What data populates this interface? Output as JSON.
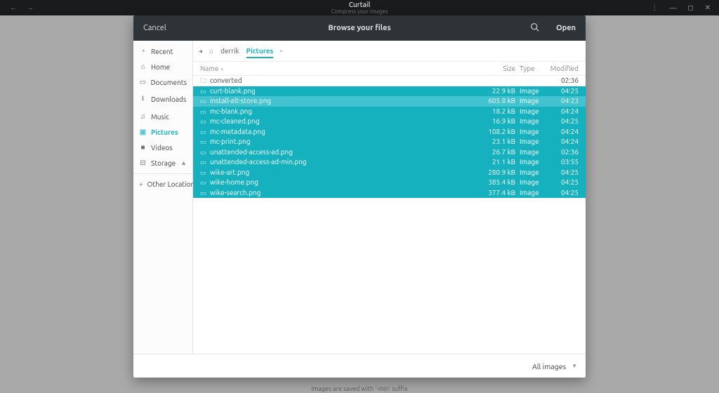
{
  "shell": {
    "app_title": "Curtail",
    "subtitle": "Compress your images"
  },
  "dialog": {
    "cancel": "Cancel",
    "title": "Browse your files",
    "open": "Open",
    "filter_label": "All images"
  },
  "sidebar": {
    "items": [
      {
        "icon": "◔",
        "label": "Recent"
      },
      {
        "icon": "⌂",
        "label": "Home"
      },
      {
        "icon": "▭",
        "label": "Documents"
      },
      {
        "icon": "⭳",
        "label": "Downloads"
      },
      {
        "icon": "♫",
        "label": "Music"
      },
      {
        "icon": "▣",
        "label": "Pictures"
      },
      {
        "icon": "■",
        "label": "Videos"
      },
      {
        "icon": "⊟",
        "label": "Storage"
      }
    ],
    "other_loc": "Other Locations"
  },
  "crumbs": {
    "seg1": "derrik",
    "seg2": "Pictures"
  },
  "columns": {
    "name": "Name",
    "size": "Size",
    "type": "Type",
    "modified": "Modified"
  },
  "files": [
    {
      "kind": "folder",
      "name": "converted",
      "size": "",
      "type": "",
      "mod": "02:36",
      "sel": false
    },
    {
      "kind": "image",
      "name": "curt-blank.png",
      "size": "22.9 kB",
      "type": "Image",
      "mod": "04:25",
      "sel": true
    },
    {
      "kind": "image",
      "name": "install-alt-store.png",
      "size": "605.8 kB",
      "type": "Image",
      "mod": "04:23",
      "sel": true,
      "focus": true
    },
    {
      "kind": "image",
      "name": "mc-blank.png",
      "size": "18.2 kB",
      "type": "Image",
      "mod": "04:24",
      "sel": true
    },
    {
      "kind": "image",
      "name": "mc-cleaned.png",
      "size": "16.9 kB",
      "type": "Image",
      "mod": "04:25",
      "sel": true
    },
    {
      "kind": "image",
      "name": "mc-metadata.png",
      "size": "108.2 kB",
      "type": "Image",
      "mod": "04:24",
      "sel": true
    },
    {
      "kind": "image",
      "name": "mc-print.png",
      "size": "23.1 kB",
      "type": "Image",
      "mod": "04:24",
      "sel": true
    },
    {
      "kind": "image",
      "name": "unattended-access-ad.png",
      "size": "26.7 kB",
      "type": "Image",
      "mod": "02:36",
      "sel": true
    },
    {
      "kind": "image",
      "name": "unattended-access-ad-min.png",
      "size": "21.1 kB",
      "type": "Image",
      "mod": "03:55",
      "sel": true
    },
    {
      "kind": "image",
      "name": "wike-art.png",
      "size": "280.9 kB",
      "type": "Image",
      "mod": "04:25",
      "sel": true
    },
    {
      "kind": "image",
      "name": "wike-home.png",
      "size": "385.4 kB",
      "type": "Image",
      "mod": "04:25",
      "sel": true
    },
    {
      "kind": "image",
      "name": "wike-search.png",
      "size": "377.4 kB",
      "type": "Image",
      "mod": "04:25",
      "sel": true
    }
  ],
  "drag_hint": "Images are saved with '-min' suffix"
}
